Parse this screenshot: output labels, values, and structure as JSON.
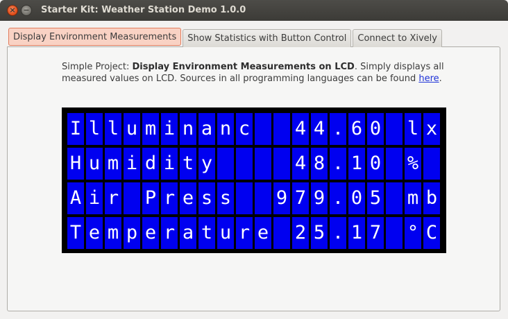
{
  "window": {
    "title": "Starter Kit: Weather Station Demo 1.0.0",
    "close_glyph": "×",
    "minimize_glyph": "−"
  },
  "tabs": [
    {
      "label": "Display Environment Measurements",
      "active": true
    },
    {
      "label": "Show Statistics with Button Control",
      "active": false
    },
    {
      "label": "Connect to Xively",
      "active": false
    }
  ],
  "description": {
    "prefix": "Simple Project: ",
    "bold": "Display Environment Measurements on LCD",
    "middle": ". Simply displays all measured values on LCD. Sources in all programming languages can be found ",
    "link": "here",
    "suffix": "."
  },
  "lcd": {
    "columns": 20,
    "rows": [
      "Illuminanc  44.60 lx",
      "Humidity    48.10 % ",
      "Air Press  979.05 mb",
      "Temperature 25.17 °C"
    ],
    "colors": {
      "background": "#000000",
      "cell": "#0000f0",
      "text": "#ffffff"
    }
  }
}
